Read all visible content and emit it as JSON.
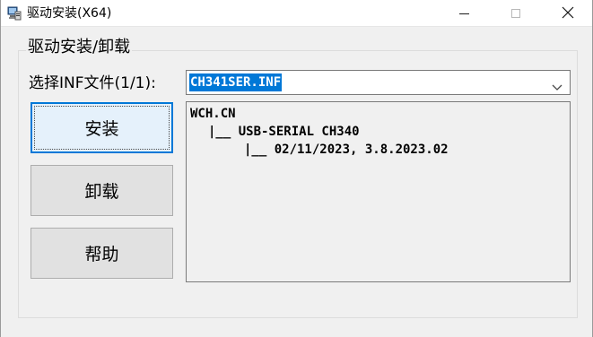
{
  "window": {
    "title": "驱动安装(X64)",
    "icons": {
      "app": "computer-driver-icon",
      "minimize": "minimize-icon",
      "maximize": "maximize-icon",
      "close": "close-icon"
    }
  },
  "group": {
    "legend": "驱动安装/卸载"
  },
  "inf_selector": {
    "label": "选择INF文件(1/1):",
    "selected": "CH341SER.INF",
    "dropdown_icon": "chevron-down-icon"
  },
  "buttons": {
    "install": "安装",
    "uninstall": "卸载",
    "help": "帮助"
  },
  "info": {
    "vendor": "WCH.CN",
    "device": "|__ USB-SERIAL CH340",
    "version": "|__ 02/11/2023, 3.8.2023.02"
  },
  "colors": {
    "accent": "#0078d7",
    "window_bg": "#f0f0f0",
    "button_bg": "#e1e1e1"
  }
}
